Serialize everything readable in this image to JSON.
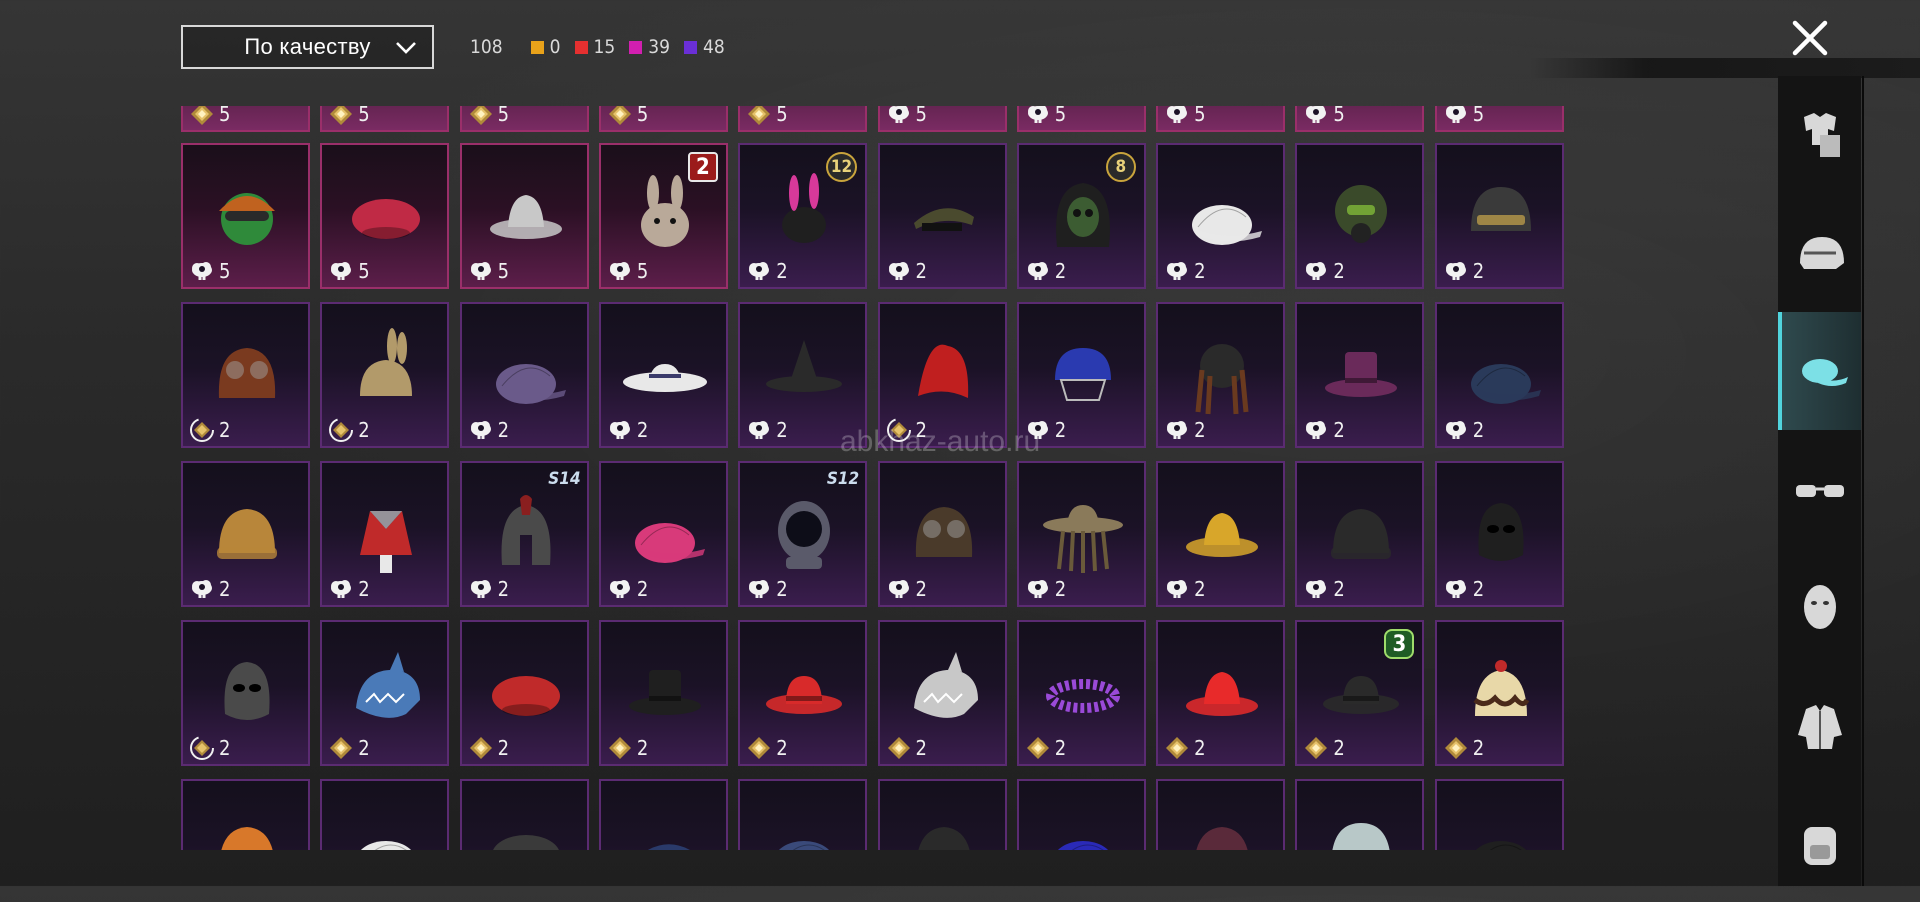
{
  "sort": {
    "label": "По качеству"
  },
  "counts": {
    "total": "108",
    "items": [
      {
        "color": "#e8a21a",
        "value": "0"
      },
      {
        "color": "#e53030",
        "value": "15"
      },
      {
        "color": "#d21fb0",
        "value": "39"
      },
      {
        "color": "#6a2fd6",
        "value": "48"
      }
    ]
  },
  "watermark": "abkhaz-auto.ru",
  "sidebar": [
    "outfit-icon",
    "helmet-icon",
    "cap-icon",
    "glasses-icon",
    "face-icon",
    "jacket-icon",
    "backpack-icon"
  ],
  "rows": [
    {
      "partial": true,
      "tiles": [
        {
          "cur": "gold",
          "price": "5"
        },
        {
          "cur": "gold",
          "price": "5"
        },
        {
          "cur": "gold",
          "price": "5"
        },
        {
          "cur": "gold",
          "price": "5"
        },
        {
          "cur": "gold",
          "price": "5"
        },
        {
          "cur": "cloud",
          "price": "5"
        },
        {
          "cur": "cloud",
          "price": "5"
        },
        {
          "cur": "cloud",
          "price": "5"
        },
        {
          "cur": "cloud",
          "price": "5"
        },
        {
          "cur": "cloud",
          "price": "5"
        }
      ]
    },
    {
      "tiles": [
        {
          "cur": "cloud",
          "price": "5",
          "pink": true,
          "art": "goggle-helmet",
          "color": "#c0621f"
        },
        {
          "cur": "cloud",
          "price": "5",
          "pink": true,
          "art": "beret",
          "color": "#c02a45"
        },
        {
          "cur": "cloud",
          "price": "5",
          "pink": true,
          "art": "bucket",
          "color": "#c8c8c8"
        },
        {
          "cur": "cloud",
          "price": "5",
          "pink": true,
          "art": "bunny",
          "color": "#b9a999",
          "badge": {
            "type": "red",
            "text": "2"
          }
        },
        {
          "cur": "cloud",
          "price": "2",
          "art": "bunny-ears",
          "color": "#d8399a",
          "badge": {
            "type": "gold",
            "text": "12"
          }
        },
        {
          "cur": "cloud",
          "price": "2",
          "art": "officer",
          "color": "#4a4a2e"
        },
        {
          "cur": "cloud",
          "price": "2",
          "art": "hood",
          "color": "#3c5c32",
          "badge": {
            "type": "gold",
            "text": "8"
          }
        },
        {
          "cur": "cloud",
          "price": "2",
          "art": "cap",
          "color": "#e8e8e8"
        },
        {
          "cur": "cloud",
          "price": "2",
          "art": "gasmask",
          "color": "#3a4a2a"
        },
        {
          "cur": "cloud",
          "price": "2",
          "art": "helmet",
          "color": "#3a3a3a"
        }
      ]
    },
    {
      "tiles": [
        {
          "cur": "gold-ring",
          "price": "2",
          "art": "aviator",
          "color": "#7a3a1f"
        },
        {
          "cur": "gold-ring",
          "price": "2",
          "art": "bunny-hood",
          "color": "#b29a6a"
        },
        {
          "cur": "cloud",
          "price": "2",
          "art": "cap",
          "color": "#6a5a8a"
        },
        {
          "cur": "cloud",
          "price": "2",
          "art": "sunhat",
          "color": "#e8e8e8"
        },
        {
          "cur": "cloud",
          "price": "2",
          "art": "witch",
          "color": "#2a2a2a"
        },
        {
          "cur": "gold-ring",
          "price": "2",
          "art": "mohawk",
          "color": "#c01f1f"
        },
        {
          "cur": "cloud",
          "price": "2",
          "art": "cricket",
          "color": "#2a3ab0"
        },
        {
          "cur": "cloud",
          "price": "2",
          "art": "dreads",
          "color": "#6a3a1f"
        },
        {
          "cur": "cloud",
          "price": "2",
          "art": "tophat",
          "color": "#6a2a5a"
        },
        {
          "cur": "cloud",
          "price": "2",
          "art": "cap",
          "color": "#2a3a5a"
        }
      ]
    },
    {
      "tiles": [
        {
          "cur": "cloud",
          "price": "2",
          "art": "beanie",
          "color": "#b8863a"
        },
        {
          "cur": "cloud",
          "price": "2",
          "art": "jester",
          "color": "#c02a2a"
        },
        {
          "cur": "cloud",
          "price": "2",
          "art": "spartan",
          "color": "#4a4a4a",
          "season": "S14"
        },
        {
          "cur": "cloud",
          "price": "2",
          "art": "cap",
          "color": "#d83a7a"
        },
        {
          "cur": "cloud",
          "price": "2",
          "art": "astronaut",
          "color": "#5a5a6a",
          "season": "S12"
        },
        {
          "cur": "cloud",
          "price": "2",
          "art": "aviator",
          "color": "#4a3a2a"
        },
        {
          "cur": "cloud",
          "price": "2",
          "art": "scarecrow",
          "color": "#8a7a5a"
        },
        {
          "cur": "cloud",
          "price": "2",
          "art": "bucket",
          "color": "#d8a62a"
        },
        {
          "cur": "cloud",
          "price": "2",
          "art": "beanie",
          "color": "#2a2a2a"
        },
        {
          "cur": "cloud",
          "price": "2",
          "art": "balaclava",
          "color": "#1f1f1f"
        }
      ]
    },
    {
      "tiles": [
        {
          "cur": "gold-ring",
          "price": "2",
          "art": "balaclava",
          "color": "#4a4a4a"
        },
        {
          "cur": "gold",
          "price": "2",
          "art": "shark",
          "color": "#4a7ab8"
        },
        {
          "cur": "gold",
          "price": "2",
          "art": "beret",
          "color": "#c02a2a"
        },
        {
          "cur": "gold",
          "price": "2",
          "art": "tophat",
          "color": "#1f1f1f"
        },
        {
          "cur": "gold",
          "price": "2",
          "art": "fedora",
          "color": "#d82a2a"
        },
        {
          "cur": "gold",
          "price": "2",
          "art": "shark",
          "color": "#c8c8c8"
        },
        {
          "cur": "gold",
          "price": "2",
          "art": "wreath",
          "color": "#9a4ad8"
        },
        {
          "cur": "gold",
          "price": "2",
          "art": "bucket",
          "color": "#e82a2a"
        },
        {
          "cur": "gold",
          "price": "2",
          "art": "fedora",
          "color": "#2a2a2a",
          "badge": {
            "type": "green",
            "text": "3"
          }
        },
        {
          "cur": "gold",
          "price": "2",
          "art": "cake",
          "color": "#e8d8a8"
        }
      ]
    },
    {
      "cut": true,
      "tiles": [
        {
          "art": "beanie",
          "color": "#d8782a"
        },
        {
          "art": "cap",
          "color": "#e8e8e8"
        },
        {
          "art": "beret",
          "color": "#3a3a3a"
        },
        {
          "art": "officer",
          "color": "#2a3a6a"
        },
        {
          "art": "cap",
          "color": "#3a4a7a"
        },
        {
          "art": "beanie",
          "color": "#2a2a2a"
        },
        {
          "art": "cap",
          "color": "#2a2ab8"
        },
        {
          "art": "beanie",
          "color": "#5a2a3a"
        },
        {
          "art": "helmet",
          "color": "#b8c8c8"
        },
        {
          "art": "cap",
          "color": "#1f1f1f"
        }
      ]
    }
  ]
}
